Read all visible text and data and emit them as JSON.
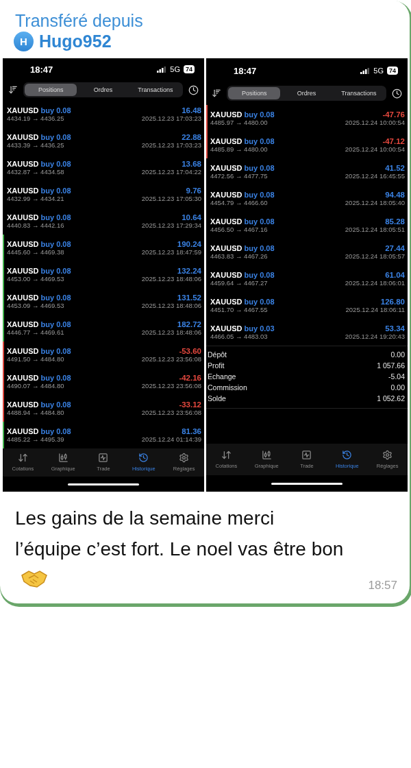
{
  "forward": {
    "label": "Transféré depuis",
    "avatar": "H",
    "name": "Hugo952"
  },
  "screenshots": [
    {
      "time": "18:47",
      "network": "5G",
      "battery": "74",
      "segments": [
        {
          "label": "Positions",
          "selected": true
        },
        {
          "label": "Ordres",
          "selected": false
        },
        {
          "label": "Transactions",
          "selected": false
        }
      ],
      "trades": [
        {
          "symbol": "XAUUSD",
          "side": "buy 0.08",
          "prices": "4434.19 → 4436.25",
          "profit": "16.48",
          "time": "2025.12.23 17:03:23",
          "loss": false,
          "marked": false
        },
        {
          "symbol": "XAUUSD",
          "side": "buy 0.08",
          "prices": "4433.39 → 4436.25",
          "profit": "22.88",
          "time": "2025.12.23 17:03:23",
          "loss": false,
          "marked": false
        },
        {
          "symbol": "XAUUSD",
          "side": "buy 0.08",
          "prices": "4432.87 → 4434.58",
          "profit": "13.68",
          "time": "2025.12.23 17:04:22",
          "loss": false,
          "marked": false
        },
        {
          "symbol": "XAUUSD",
          "side": "buy 0.08",
          "prices": "4432.99 → 4434.21",
          "profit": "9.76",
          "time": "2025.12.23 17:05:30",
          "loss": false,
          "marked": false
        },
        {
          "symbol": "XAUUSD",
          "side": "buy 0.08",
          "prices": "4440.83 → 4442.16",
          "profit": "10.64",
          "time": "2025.12.23 17:29:34",
          "loss": false,
          "marked": false
        },
        {
          "symbol": "XAUUSD",
          "side": "buy 0.08",
          "prices": "4445.60 → 4469.38",
          "profit": "190.24",
          "time": "2025.12.23 18:47:59",
          "loss": false,
          "marked": true
        },
        {
          "symbol": "XAUUSD",
          "side": "buy 0.08",
          "prices": "4453.00 → 4469.53",
          "profit": "132.24",
          "time": "2025.12.23 18:48:06",
          "loss": false,
          "marked": true
        },
        {
          "symbol": "XAUUSD",
          "side": "buy 0.08",
          "prices": "4453.09 → 4469.53",
          "profit": "131.52",
          "time": "2025.12.23 18:48:06",
          "loss": false,
          "marked": true
        },
        {
          "symbol": "XAUUSD",
          "side": "buy 0.08",
          "prices": "4446.77 → 4469.61",
          "profit": "182.72",
          "time": "2025.12.23 18:48:06",
          "loss": false,
          "marked": true
        },
        {
          "symbol": "XAUUSD",
          "side": "buy 0.08",
          "prices": "4491.50 → 4484.80",
          "profit": "-53.60",
          "time": "2025.12.23 23:56:08",
          "loss": true,
          "marked": true
        },
        {
          "symbol": "XAUUSD",
          "side": "buy 0.08",
          "prices": "4490.07 → 4484.80",
          "profit": "-42.16",
          "time": "2025.12.23 23:56:08",
          "loss": true,
          "marked": true
        },
        {
          "symbol": "XAUUSD",
          "side": "buy 0.08",
          "prices": "4488.94 → 4484.80",
          "profit": "-33.12",
          "time": "2025.12.23 23:56:08",
          "loss": true,
          "marked": true
        },
        {
          "symbol": "XAUUSD",
          "side": "buy 0.08",
          "prices": "4485.22 → 4495.39",
          "profit": "81.36",
          "time": "2025.12.24 01:14:39",
          "loss": false,
          "marked": true
        }
      ],
      "nav": [
        {
          "label": "Cotations",
          "selected": false
        },
        {
          "label": "Graphique",
          "selected": false
        },
        {
          "label": "Trade",
          "selected": false
        },
        {
          "label": "Historique",
          "selected": true
        },
        {
          "label": "Réglages",
          "selected": false
        }
      ]
    },
    {
      "time": "18:47",
      "network": "5G",
      "battery": "74",
      "segments": [
        {
          "label": "Positions",
          "selected": true
        },
        {
          "label": "Ordres",
          "selected": false
        },
        {
          "label": "Transactions",
          "selected": false
        }
      ],
      "trades": [
        {
          "symbol": "XAUUSD",
          "side": "buy 0.08",
          "prices": "4485.97 → 4480.00",
          "profit": "-47.76",
          "time": "2025.12.24 10:00:54",
          "loss": true,
          "marked": true
        },
        {
          "symbol": "XAUUSD",
          "side": "buy 0.08",
          "prices": "4485.89 → 4480.00",
          "profit": "-47.12",
          "time": "2025.12.24 10:00:54",
          "loss": true,
          "marked": true
        },
        {
          "symbol": "XAUUSD",
          "side": "buy 0.08",
          "prices": "4472.56 → 4477.75",
          "profit": "41.52",
          "time": "2025.12.24 16:45:55",
          "loss": false,
          "marked": false
        },
        {
          "symbol": "XAUUSD",
          "side": "buy 0.08",
          "prices": "4454.79 → 4466.60",
          "profit": "94.48",
          "time": "2025.12.24 18:05:40",
          "loss": false,
          "marked": false
        },
        {
          "symbol": "XAUUSD",
          "side": "buy 0.08",
          "prices": "4456.50 → 4467.16",
          "profit": "85.28",
          "time": "2025.12.24 18:05:51",
          "loss": false,
          "marked": false
        },
        {
          "symbol": "XAUUSD",
          "side": "buy 0.08",
          "prices": "4463.83 → 4467.26",
          "profit": "27.44",
          "time": "2025.12.24 18:05:57",
          "loss": false,
          "marked": false
        },
        {
          "symbol": "XAUUSD",
          "side": "buy 0.08",
          "prices": "4459.64 → 4467.27",
          "profit": "61.04",
          "time": "2025.12.24 18:06:01",
          "loss": false,
          "marked": false
        },
        {
          "symbol": "XAUUSD",
          "side": "buy 0.08",
          "prices": "4451.70 → 4467.55",
          "profit": "126.80",
          "time": "2025.12.24 18:06:11",
          "loss": false,
          "marked": false
        },
        {
          "symbol": "XAUUSD",
          "side": "buy 0.03",
          "prices": "4466.05 → 4483.03",
          "profit": "53.34",
          "time": "2025.12.24 19:20:43",
          "loss": false,
          "marked": false
        }
      ],
      "summary": [
        {
          "label": "Dépôt",
          "value": "0.00"
        },
        {
          "label": "Profit",
          "value": "1 057.66"
        },
        {
          "label": "Echange",
          "value": "-5.04"
        },
        {
          "label": "Commission",
          "value": "0.00"
        },
        {
          "label": "Solde",
          "value": "1 052.62"
        }
      ],
      "nav": [
        {
          "label": "Cotations",
          "selected": false
        },
        {
          "label": "Graphique",
          "selected": false
        },
        {
          "label": "Trade",
          "selected": false
        },
        {
          "label": "Historique",
          "selected": true
        },
        {
          "label": "Réglages",
          "selected": false
        }
      ]
    }
  ],
  "message": {
    "text": "Les gains de la semaine merci l’équipe c’est fort. Le noel vas être bon",
    "time": "18:57"
  }
}
